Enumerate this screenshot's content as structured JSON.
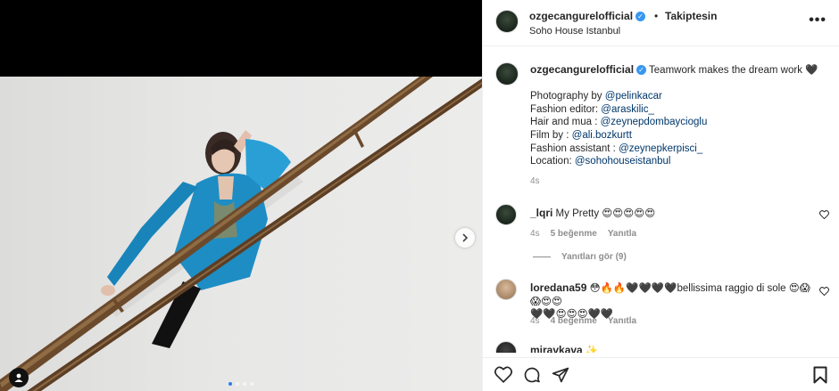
{
  "post": {
    "username": "ozgecangurelofficial",
    "follow_label": "Takiptesin",
    "bullet": "•",
    "location": "Soho House Istanbul",
    "more_label": "•••"
  },
  "caption": {
    "username": "ozgecangurelofficial",
    "text": "Teamwork makes the dream work 🖤",
    "credits": [
      {
        "prefix": "Photography by ",
        "handle": "@pelinkacar"
      },
      {
        "prefix": "Fashion editor: ",
        "handle": "@araskilic_"
      },
      {
        "prefix": "Hair and mua : ",
        "handle": "@zeynepdombaycioglu"
      },
      {
        "prefix": "Film by : ",
        "handle": "@ali.bozkurtt"
      },
      {
        "prefix": "Fashion assistant : ",
        "handle": "@zeynepkerpisci_"
      },
      {
        "prefix": "Location: ",
        "handle": "@sohohouseistanbul"
      }
    ],
    "time": "4s"
  },
  "comments": [
    {
      "username": "_lqri",
      "text": "My Pretty 😍😍😍😍😍",
      "time": "4s",
      "likes": "5 beğenme",
      "reply": "Yanıtla",
      "view_replies": "Yanıtları gör (9)"
    },
    {
      "username": "loredana59",
      "text_line1": "😳🔥🔥🖤🖤🖤🖤bellissima raggio di sole 😍😱😱😍😍",
      "text_line2": "🖤🖤😍😍😍🖤🖤",
      "time": "4s",
      "likes": "4 beğenme",
      "reply": "Yanıtla"
    },
    {
      "username": "miravkava",
      "text": "✨"
    }
  ],
  "carousel": {
    "count": 4,
    "active": 0
  },
  "colors": {
    "jacket": "#1f8fc4",
    "rail": "#6b4a2c",
    "link": "#00376b",
    "verified": "#3897f0"
  }
}
